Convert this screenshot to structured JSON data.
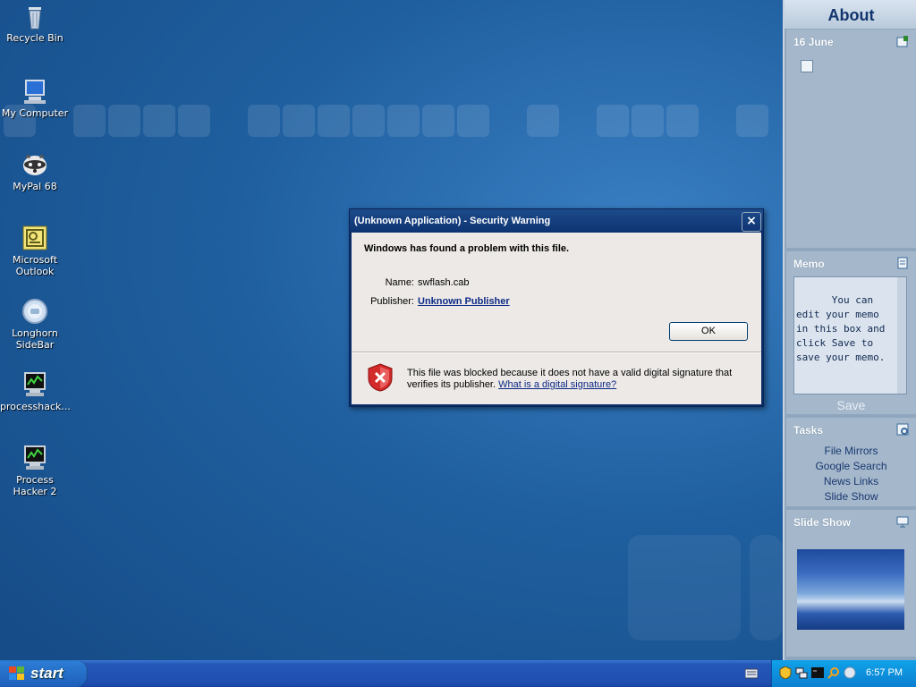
{
  "desktop": {
    "icons": [
      {
        "label": "Recycle Bin",
        "icon": "recycle-bin-icon"
      },
      {
        "label": "My Computer",
        "icon": "my-computer-icon"
      },
      {
        "label": "MyPal 68",
        "icon": "mypal-icon"
      },
      {
        "label": "Microsoft Outlook",
        "icon": "outlook-icon"
      },
      {
        "label": "Longhorn SideBar",
        "icon": "longhorn-sidebar-icon"
      },
      {
        "label": "processhack...",
        "icon": "processhacker-icon"
      },
      {
        "label": "Process Hacker 2",
        "icon": "processhacker2-icon"
      }
    ]
  },
  "dialog": {
    "title": "(Unknown Application) - Security Warning",
    "close_label": "×",
    "heading": "Windows has found a problem with this file.",
    "name_key": "Name:",
    "name_value": "swflash.cab",
    "publisher_key": "Publisher:",
    "publisher_value": "Unknown Publisher",
    "ok_label": "OK",
    "warning_text": "This file was blocked because it does not have a valid digital signature that verifies its publisher.",
    "warning_link": "What is a digital signature?"
  },
  "sidebar": {
    "about": "About",
    "date": "16 June",
    "memo": {
      "title": "Memo",
      "text": "You can edit your memo in this box and click Save to save your memo.",
      "save_label": "Save"
    },
    "tasks": {
      "title": "Tasks",
      "items": [
        "File Mirrors",
        "Google Search",
        "News Links",
        "Slide Show"
      ]
    },
    "slideshow": {
      "title": "Slide Show"
    }
  },
  "taskbar": {
    "start_label": "start",
    "clock": "6:57 PM"
  }
}
